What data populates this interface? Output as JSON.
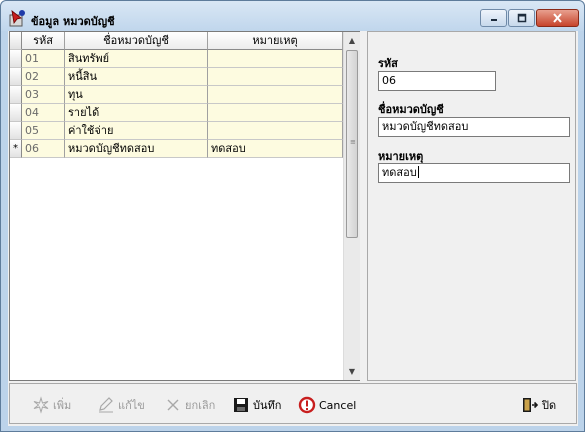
{
  "window": {
    "title": "ข้อมูล หมวดบัญชี",
    "buttons": {
      "minimize": "minimize",
      "maximize": "maximize",
      "close": "close"
    }
  },
  "grid": {
    "columns": [
      "รหัส",
      "ชื่อหมวดบัญชี",
      "หมายเหตุ"
    ],
    "rows": [
      {
        "code": "01",
        "name": "สินทรัพย์",
        "note": ""
      },
      {
        "code": "02",
        "name": "หนี้สิน",
        "note": ""
      },
      {
        "code": "03",
        "name": "ทุน",
        "note": ""
      },
      {
        "code": "04",
        "name": "รายได้",
        "note": ""
      },
      {
        "code": "05",
        "name": "ค่าใช้จ่าย",
        "note": ""
      },
      {
        "code": "06",
        "name": "หมวดบัญชีทดสอบ",
        "note": "ทดสอบ",
        "marker": "*"
      }
    ]
  },
  "form": {
    "code_label": "รหัส",
    "code_value": "06",
    "name_label": "ชื่อหมวดบัญชี",
    "name_value": "หมวดบัญชีทดสอบ",
    "note_label": "หมายเหตุ",
    "note_value": "ทดสอบ"
  },
  "toolbar": {
    "add": "เพิ่ม",
    "edit": "แก้ไข",
    "cancel_record": "ยกเลิก",
    "save": "บันทึก",
    "cancel": "Cancel",
    "close": "ปิด"
  },
  "colors": {
    "row_background": "#fdfbe0",
    "window_frame": "#bcd3ea",
    "close_button": "#c7442b"
  }
}
